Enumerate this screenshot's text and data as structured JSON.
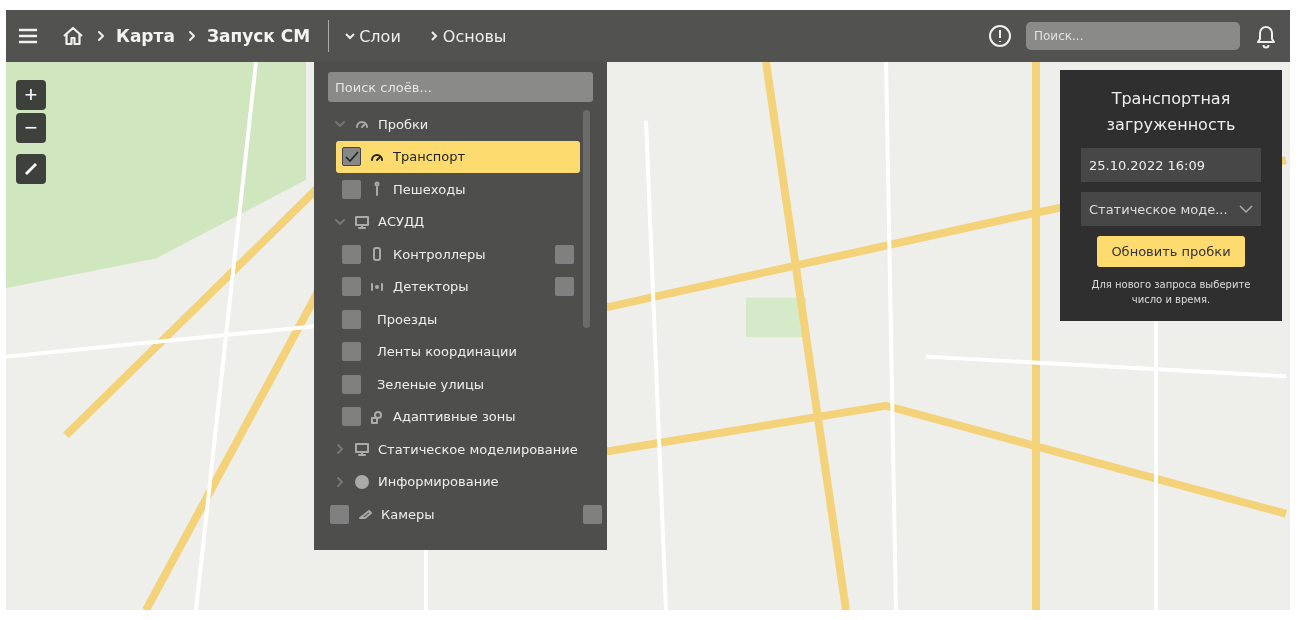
{
  "top_bar": {
    "breadcrumbs": [
      "Карта",
      "Запуск СМ"
    ],
    "menus": [
      {
        "label": "Слои",
        "expanded": true
      },
      {
        "label": "Основы",
        "expanded": false
      }
    ],
    "search": {
      "placeholder": "Поиск..."
    }
  },
  "map_controls": {
    "zoom_in": "+",
    "zoom_out": "−"
  },
  "layers_panel": {
    "search": {
      "placeholder": "Поиск слоёв..."
    },
    "items": [
      {
        "kind": "group",
        "label": "Пробки",
        "expanded": true,
        "children": [
          {
            "kind": "layer",
            "label": "Транспорт",
            "checked": true,
            "selected": true
          },
          {
            "kind": "layer",
            "label": "Пешеходы",
            "checked": false,
            "selected": false
          }
        ]
      },
      {
        "kind": "group",
        "label": "АСУДД",
        "expanded": true,
        "children": [
          {
            "kind": "layer",
            "label": "Контроллеры",
            "checked": false,
            "selected": false,
            "side_checked": false
          },
          {
            "kind": "layer",
            "label": "Детекторы",
            "checked": false,
            "selected": false,
            "side_checked": false
          },
          {
            "kind": "layer",
            "label": "Проезды",
            "checked": false,
            "selected": false
          },
          {
            "kind": "layer",
            "label": "Ленты координации",
            "checked": false,
            "selected": false
          },
          {
            "kind": "layer",
            "label": "Зеленые улицы",
            "checked": false,
            "selected": false
          },
          {
            "kind": "layer",
            "label": "Адаптивные зоны",
            "checked": false,
            "selected": false
          }
        ]
      },
      {
        "kind": "group",
        "label": "Статическое моделирование",
        "expanded": false
      },
      {
        "kind": "group",
        "label": "Информирование",
        "expanded": false
      },
      {
        "kind": "layer",
        "label": "Камеры",
        "checked": false,
        "selected": false,
        "side_checked": false
      }
    ]
  },
  "traffic_panel": {
    "title": "Транспортная загруженность",
    "datetime": "25.10.2022 16:09",
    "mode": "Статическое моде...",
    "button": "Обновить пробки",
    "hint": "Для нового запроса выберите число и время."
  }
}
